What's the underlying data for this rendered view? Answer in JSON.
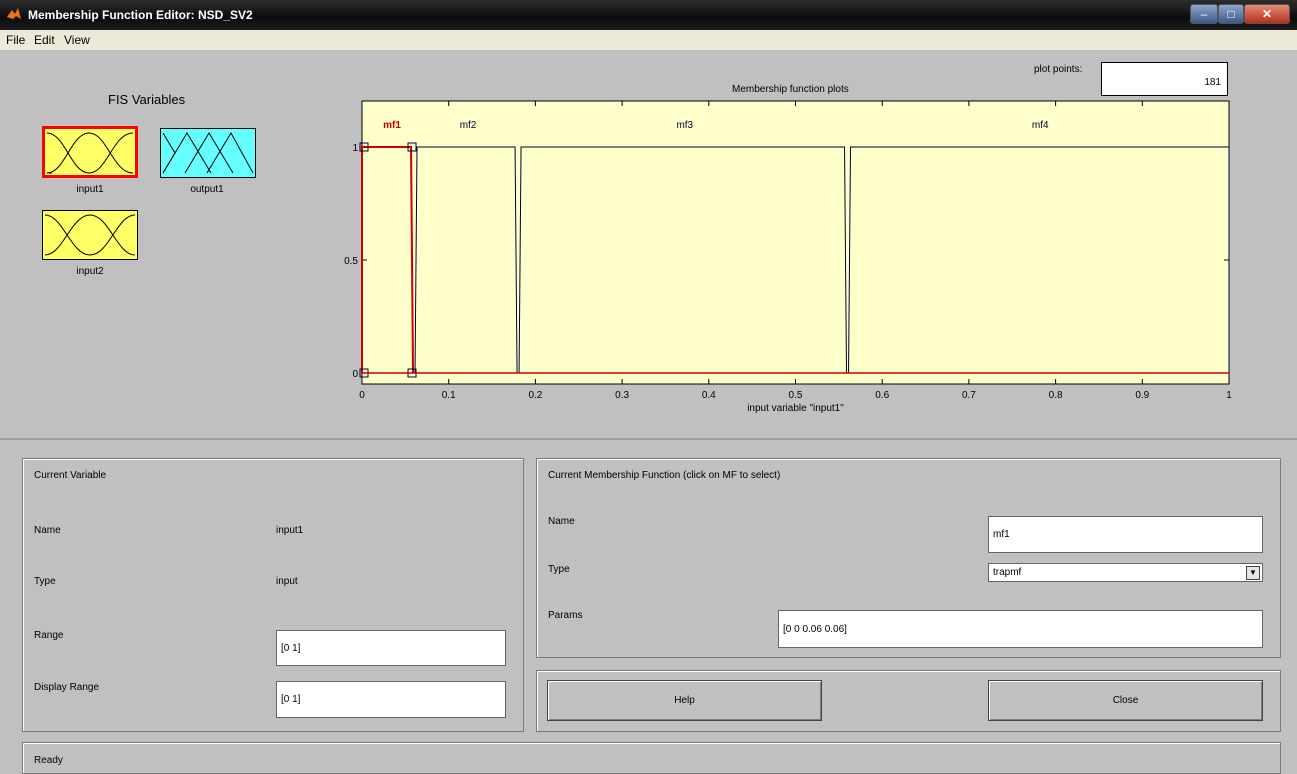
{
  "window": {
    "title": "Membership Function Editor: NSD_SV2"
  },
  "menu": [
    "File",
    "Edit",
    "View"
  ],
  "fis_variables": {
    "heading": "FIS Variables",
    "items": [
      {
        "label": "input1",
        "kind": "input",
        "selected": true
      },
      {
        "label": "output1",
        "kind": "output",
        "selected": false
      },
      {
        "label": "input2",
        "kind": "input",
        "selected": false
      }
    ]
  },
  "plot_points": {
    "label": "plot points:",
    "value": "181"
  },
  "chart_data": {
    "type": "line",
    "title": "Membership function plots",
    "xlabel": "input variable \"input1\"",
    "ylabel": "",
    "xlim": [
      0,
      1
    ],
    "ylim": [
      0,
      1
    ],
    "xticks": [
      "0",
      "0.1",
      "0.2",
      "0.3",
      "0.4",
      "0.5",
      "0.6",
      "0.7",
      "0.8",
      "0.9",
      "1"
    ],
    "yticks": [
      "0",
      "0.5",
      "1"
    ],
    "grid": false,
    "series": [
      {
        "name": "mf1",
        "type": "trapmf",
        "params": [
          0,
          0,
          0.06,
          0.06
        ],
        "selected": true
      },
      {
        "name": "mf2",
        "type": "trapmf",
        "params": [
          0.06,
          0.06,
          0.18,
          0.18
        ],
        "selected": false
      },
      {
        "name": "mf3",
        "type": "trapmf",
        "params": [
          0.18,
          0.18,
          0.56,
          0.56
        ],
        "selected": false
      },
      {
        "name": "mf4",
        "type": "trapmf",
        "params": [
          0.56,
          0.56,
          1,
          1
        ],
        "selected": false
      }
    ],
    "colors": {
      "background": "#ffffcc",
      "line": "#000033",
      "selected": "#cc0000"
    }
  },
  "current_variable": {
    "heading": "Current Variable",
    "name_label": "Name",
    "name_value": "input1",
    "type_label": "Type",
    "type_value": "input",
    "range_label": "Range",
    "range_value": "[0 1]",
    "display_range_label": "Display Range",
    "display_range_value": "[0 1]"
  },
  "current_mf": {
    "heading": "Current Membership Function (click on MF to select)",
    "name_label": "Name",
    "name_value": "mf1",
    "type_label": "Type",
    "type_value": "trapmf",
    "params_label": "Params",
    "params_value": "[0 0 0.06 0.06]"
  },
  "buttons": {
    "help": "Help",
    "close": "Close"
  },
  "status": {
    "text": "Ready"
  },
  "colors": {
    "panel": "#c0c0c0",
    "input_var": "#ffff66",
    "output_var": "#66ffff",
    "selected_border": "#ff0000"
  }
}
